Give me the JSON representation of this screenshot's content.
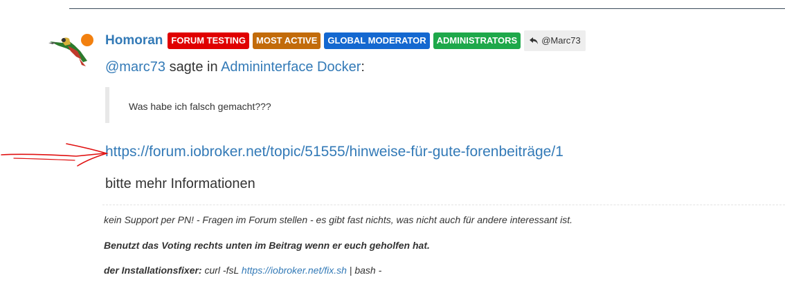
{
  "post": {
    "username": "Homoran",
    "badges": [
      {
        "label": "FORUM TESTING",
        "color": "#e00000"
      },
      {
        "label": "MOST ACTIVE",
        "color": "#c26b0a"
      },
      {
        "label": "GLOBAL MODERATOR",
        "color": "#1468d0"
      },
      {
        "label": "ADMINISTRATORS",
        "color": "#1ea84a"
      }
    ],
    "reply_to": "@Marc73",
    "status_color": "#f2800f",
    "quote": {
      "mention": "@marc73",
      "said_in": "sagte in",
      "topic": "Admininterface Docker",
      "colon": ":",
      "text": "Was habe ich falsch gemacht???"
    },
    "link": "https://forum.iobroker.net/topic/51555/hinweise-für-gute-forenbeiträge/1",
    "body": "bitte mehr Informationen"
  },
  "signature": {
    "line1": "kein Support per PN! - Fragen im Forum stellen - es gibt fast nichts, was nicht auch für andere interessant ist.",
    "line2": "Benutzt das Voting rechts unten im Beitrag wenn er euch geholfen hat.",
    "line3_label": "der Installationsfixer:",
    "line3_cmd": " curl -fsL ",
    "line3_link": "https://iobroker.net/fix.sh",
    "line3_tail": " | bash -"
  },
  "colors": {
    "link": "#337ab7",
    "annotation": "#e01010"
  }
}
